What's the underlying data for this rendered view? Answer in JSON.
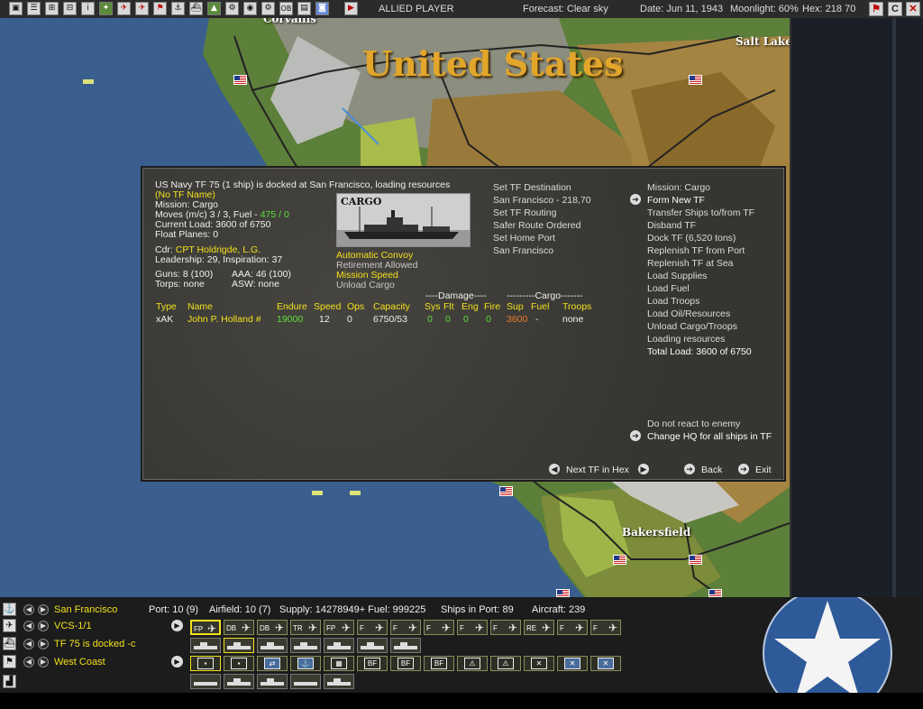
{
  "topbar": {
    "buttons": [
      "▣",
      "☰",
      "⊞",
      "⊟",
      "i",
      "✦",
      "✈",
      "✈",
      "⚑",
      "⚓",
      "⛴",
      "▲",
      "⚙",
      "◉",
      "OB",
      "▤",
      "◙"
    ],
    "end_turn": "▶",
    "side": "ALLIED PLAYER",
    "forecast": "Forecast: Clear sky",
    "date": "Date: Jun 11, 1943",
    "moonlight": "Moonlight: 60%",
    "hex": "Hex: 218 70",
    "right_buttons": [
      "⚑",
      "C",
      "✕"
    ]
  },
  "map": {
    "region_title": "United States",
    "cities": {
      "corvallis": "Corvallis",
      "salt_lake": "Salt Lake City",
      "bakersfield": "Bakersfield"
    }
  },
  "dialog": {
    "header": "US Navy TF 75 (1 ship) is docked at San Francisco, loading resources",
    "tf_name": "(No TF Name)",
    "mission": "Mission: Cargo",
    "moves_prefix": "Moves (m/c) 3 / 3, Fuel - ",
    "moves_fuel": "475 / 0",
    "current_load": "Current Load: 3600 of 6750",
    "float_planes": "Float Planes: 0",
    "cdr_prefix": "Cdr:",
    "cdr_name": "CPT Holdrigde, L.G.",
    "leadership": "Leadership: 29, Inspiration: 37",
    "guns": "Guns: 8 (100)",
    "aaa": "AAA: 46 (100)",
    "torps": "Torps: none",
    "asw": "ASW: none",
    "ship_pic_title": "CARGO",
    "orders": [
      "Automatic Convoy",
      "Retirement Allowed",
      "Mission Speed",
      "Unload Cargo"
    ],
    "destination": {
      "title": "Set TF Destination",
      "dest": "San Francisco - 218,70",
      "routing": "Set TF Routing",
      "safer": "Safer Route Ordered",
      "home": "Set Home Port",
      "home_port": "San Francisco"
    },
    "actions": {
      "mission": "Mission: Cargo",
      "form_new": "Form New TF",
      "transfer": "Transfer Ships to/from TF",
      "disband": "Disband TF",
      "dock": "Dock TF (6,520 tons)",
      "replenish_port": "Replenish TF from Port",
      "replenish_sea": "Replenish TF at Sea",
      "load_supplies": "Load Supplies",
      "load_fuel": "Load Fuel",
      "load_troops": "Load Troops",
      "load_oil": "Load Oil/Resources",
      "unload": "Unload Cargo/Troops",
      "loading": "Loading resources",
      "total_load": "Total Load: 3600 of 6750",
      "react": "Do not react to enemy",
      "change_hq": "Change HQ for all ships in TF"
    },
    "table": {
      "damage_group": "----Damage----",
      "cargo_group": "---------Cargo-------",
      "headers": [
        "Type",
        "Name",
        "Endure",
        "Speed",
        "Ops",
        "Capacity",
        "Sys",
        "Flt",
        "Eng",
        "Fire",
        "Sup",
        "Fuel",
        "Troops"
      ],
      "row": {
        "type": "xAK",
        "name": "John P. Holland #",
        "endure": "19000",
        "speed": "12",
        "ops": "0",
        "capacity": "6750/53",
        "sys": "0",
        "flt": "0",
        "eng": "0",
        "fire": "0",
        "sup": "3600",
        "fuel": "-",
        "troops": "none"
      }
    },
    "nav": {
      "next_tf": "Next TF in Hex",
      "back": "Back",
      "exit": "Exit"
    }
  },
  "bottom": {
    "base": "San Francisco",
    "port": "Port: 10 (9)",
    "airfield": "Airfield: 10 (7)",
    "supply": "Supply: 14278949+ Fuel: 999225",
    "ships_in_port": "Ships in Port: 89",
    "aircraft": "Aircraft: 239",
    "air_unit": "VCS-1/1",
    "tf_status": "TF 75 is docked -c",
    "hq": "West Coast",
    "air_slots": [
      "FP",
      "DB",
      "DB",
      "TR",
      "FP",
      "F",
      "F",
      "F",
      "F",
      "F",
      "F",
      "RE",
      "F",
      "F"
    ],
    "cmd_slots": [
      "▪",
      "▪",
      "⇄",
      "⚓",
      "▦",
      "BF",
      "BF",
      "BF",
      "⚠",
      "⚠",
      "✕",
      "✕",
      "✕"
    ]
  },
  "colors": {
    "accent_yellow": "#f2e01c",
    "green": "#5ce03a",
    "orange": "#f07a2a",
    "map_title": "#e2a62a"
  }
}
